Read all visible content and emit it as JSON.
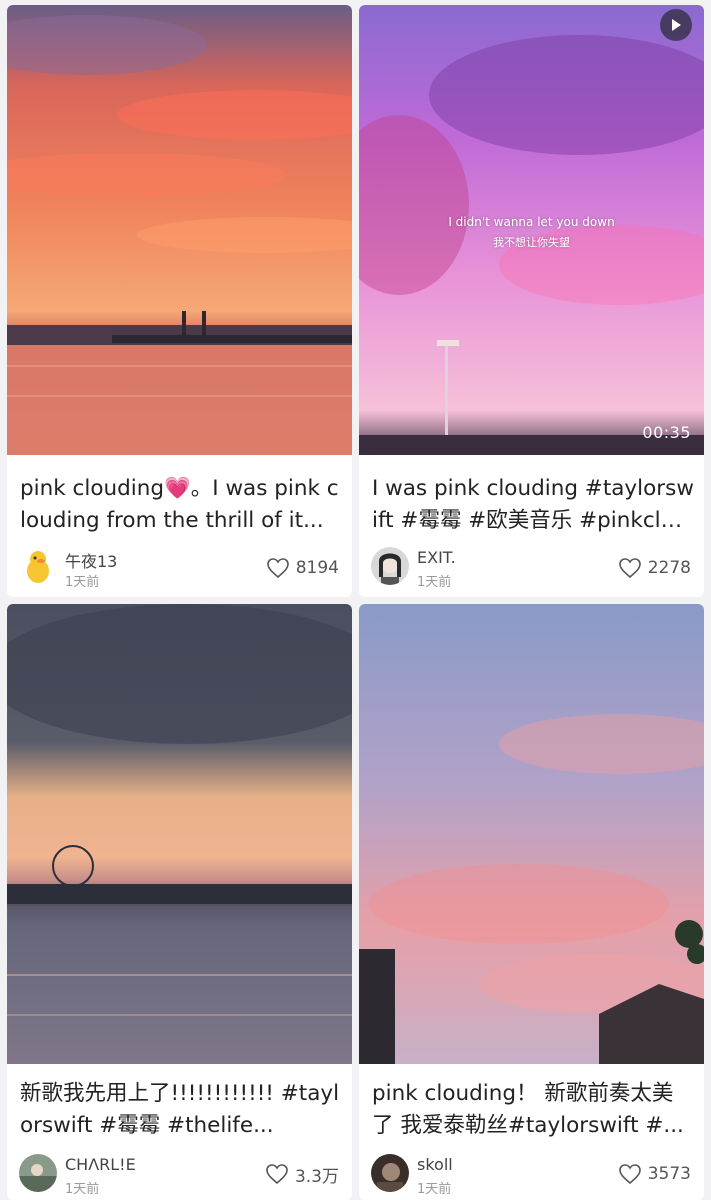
{
  "cards": [
    {
      "title": "pink clouding💗。I was pink clouding from the thrill of it...",
      "author": "午夜13",
      "time": "1天前",
      "likes": "8194"
    },
    {
      "title": "I was pink clouding #taylorswift #霉霉 #欧美音乐 #pinkclou...",
      "author": "EXIT.",
      "time": "1天前",
      "likes": "2278",
      "duration": "00:35",
      "subtitle_en": "I didn't wanna let you down",
      "subtitle_zh": "我不想让你失望"
    },
    {
      "title": "新歌我先用上了!!!!!!!!!!!! #taylorswift #霉霉 #thelife...",
      "author": "CHΛRL!E",
      "time": "1天前",
      "likes": "3.3万"
    },
    {
      "title": "pink clouding！ 新歌前奏太美了 我爱泰勒丝#taylorswift #...",
      "author": "skoll",
      "time": "1天前",
      "likes": "3573"
    }
  ],
  "icons": {
    "heart": "heart-outline-icon",
    "play": "play-icon"
  }
}
